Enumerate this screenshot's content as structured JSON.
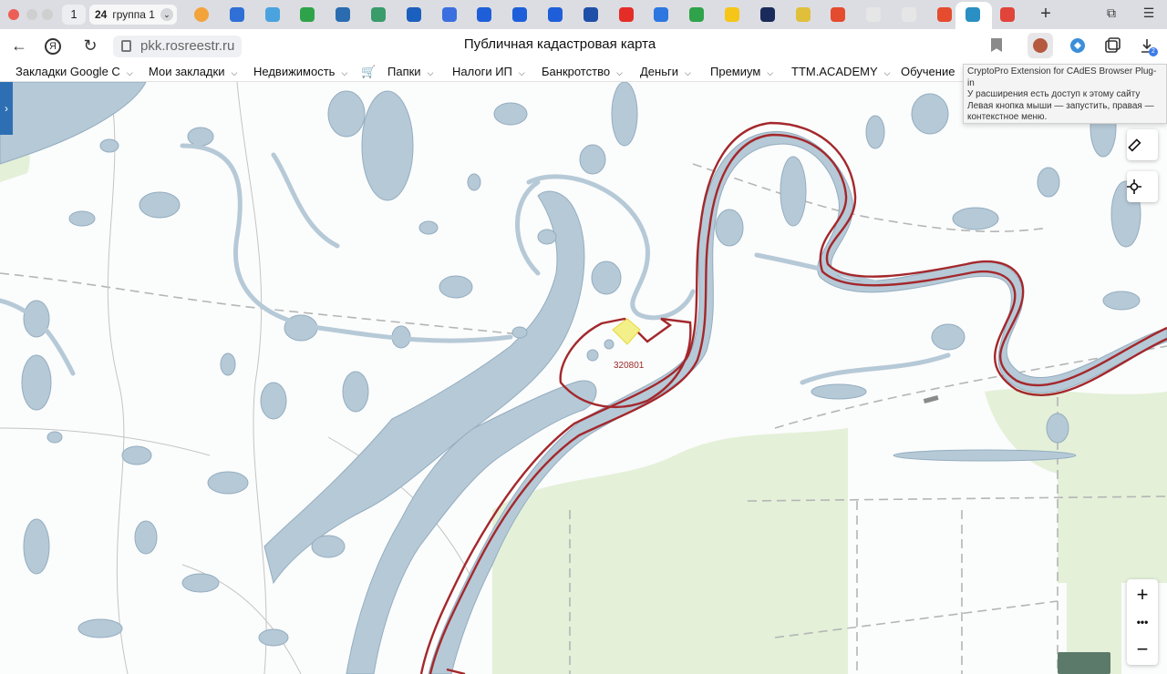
{
  "window": {
    "tab_counter": "1",
    "tab_group_count": "24",
    "tab_group_name": "группа 1"
  },
  "tabs": [
    {
      "icon": "bitcoin-icon",
      "color": "#f2a33a"
    },
    {
      "icon": "mail-icon",
      "color": "#2f6fd6"
    },
    {
      "icon": "pin-icon",
      "color": "#4aa3df"
    },
    {
      "icon": "plus-square-icon",
      "color": "#2fa34a"
    },
    {
      "icon": "hexagon-icon",
      "color": "#2b6cb0"
    },
    {
      "icon": "petals-icon",
      "color": "#3a9b6b"
    },
    {
      "icon": "wave-icon",
      "color": "#1b5fbf"
    },
    {
      "icon": "cube-icon",
      "color": "#3b6fe0"
    },
    {
      "icon": "arrow-logo-icon",
      "color": "#1e5fd9"
    },
    {
      "icon": "arrow-logo-icon",
      "color": "#1e5fd9"
    },
    {
      "icon": "arrow-logo-icon",
      "color": "#1e5fd9"
    },
    {
      "icon": "shield-icon",
      "color": "#1e4fa8"
    },
    {
      "icon": "youtube-icon",
      "color": "#e52d27"
    },
    {
      "icon": "vk-icon",
      "color": "#2c77e0"
    },
    {
      "icon": "badge-icon",
      "color": "#2fa34a"
    },
    {
      "icon": "yellow-logo-icon",
      "color": "#f5c518"
    },
    {
      "icon": "dark-logo-icon",
      "color": "#1a2a5a"
    },
    {
      "icon": "person-icon",
      "color": "#e0c03a"
    },
    {
      "icon": "yandex-icon",
      "color": "#e44b2f"
    },
    {
      "icon": "page-icon",
      "color": "#e6e6e6"
    },
    {
      "icon": "page-icon",
      "color": "#e6e6e6"
    },
    {
      "icon": "yandex-icon",
      "color": "#e44b2f"
    },
    {
      "icon": "cadastre-icon",
      "color": "#2a8fc2"
    },
    {
      "icon": "map-pin-icon",
      "color": "#e0443a"
    }
  ],
  "address_bar": {
    "url": "pkk.rosreestr.ru",
    "page_title": "Публичная кадастровая карта"
  },
  "bookmarks": [
    {
      "label": "Закладки Google C",
      "has_menu": true
    },
    {
      "label": "Мои закладки",
      "has_menu": true
    },
    {
      "label": "Недвижимость",
      "has_menu": true
    },
    {
      "label": "",
      "icon": "cart-icon"
    },
    {
      "label": "Папки",
      "has_menu": true
    },
    {
      "label": "Налоги ИП",
      "has_menu": true
    },
    {
      "label": "Банкротство",
      "has_menu": true
    },
    {
      "label": "Деньги",
      "has_menu": true
    },
    {
      "label": "Премиум",
      "has_menu": true
    },
    {
      "label": "TTM.ACADEMY",
      "has_menu": true
    },
    {
      "label": "Обучение",
      "has_menu": false
    }
  ],
  "tooltip": {
    "line1": "CryptoPro Extension for CAdES Browser Plug-in",
    "line2": "У расширения есть доступ к этому сайту",
    "line3": "Левая кнопка мыши — запустить, правая — контекстное меню."
  },
  "map": {
    "parcel_label": "320801",
    "colors": {
      "water": "#b4c8d6",
      "water_edge": "#8fa9bb",
      "boundary": "#a3282c",
      "highlight": "#f6f48a",
      "forest": "#e3f0d6",
      "road": "#b0b0b0"
    }
  },
  "controls": {
    "ruler_icon": "ruler-icon",
    "locate_icon": "crosshair-icon",
    "zoom_in": "+",
    "more": "•••",
    "zoom_out": "−"
  }
}
